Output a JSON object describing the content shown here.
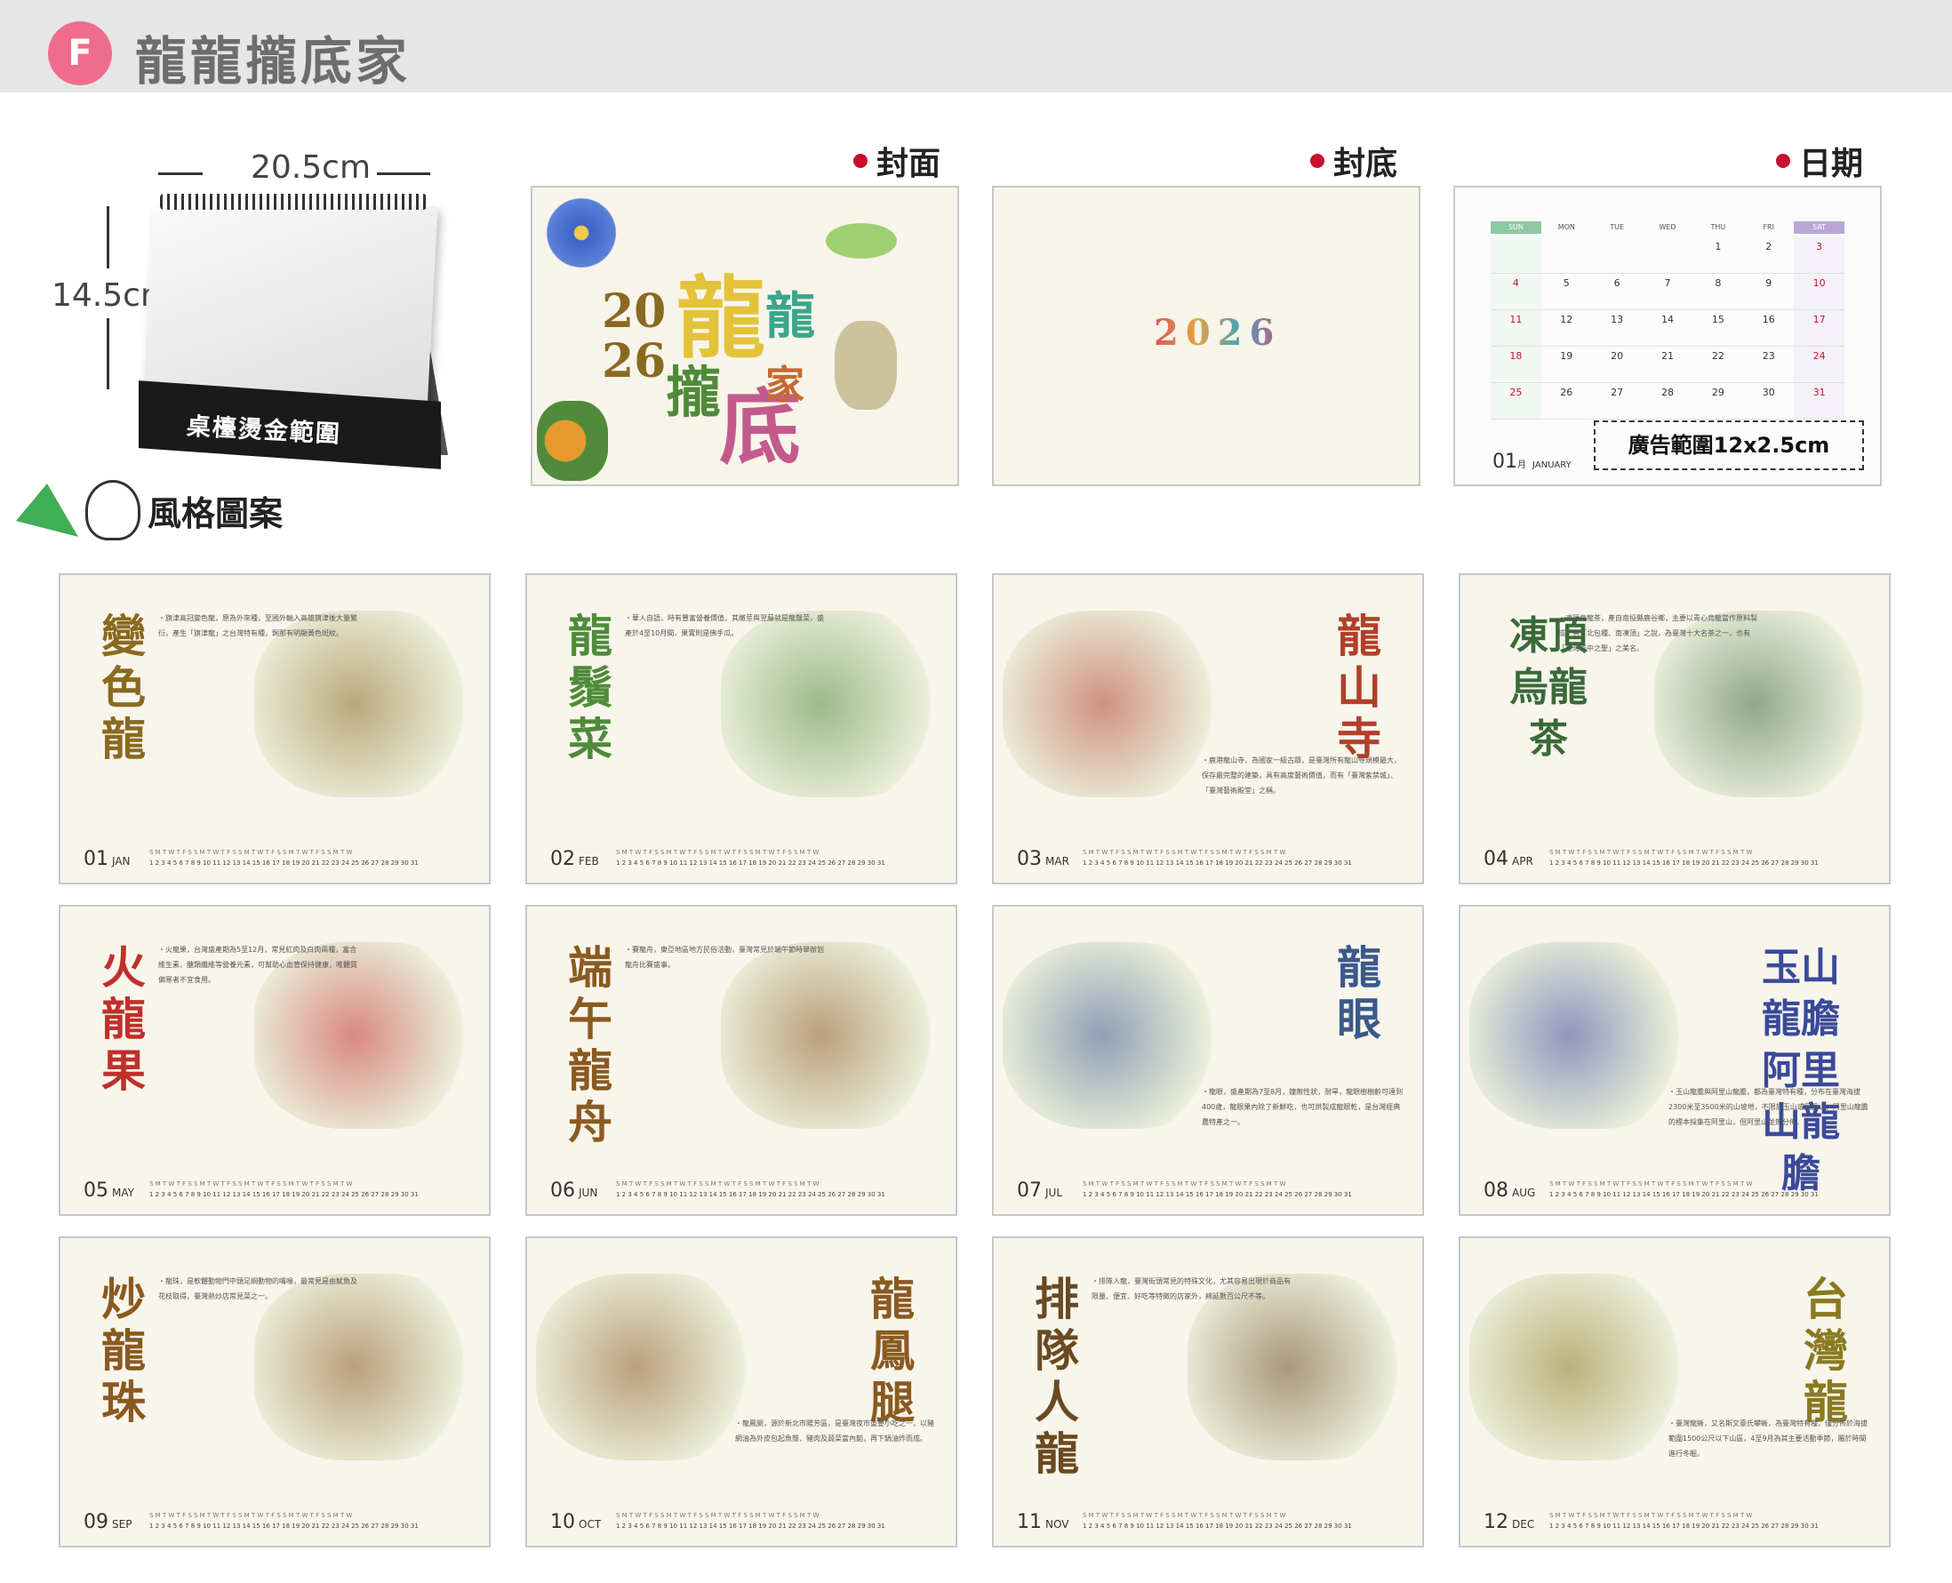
{
  "header": {
    "badge": "F",
    "title": "龍龍攏底家"
  },
  "product": {
    "width_label": "20.5cm",
    "height_label": "14.5cm",
    "base_label": "桌檯燙金範圍"
  },
  "previews": {
    "cover": {
      "label": "封面",
      "year_top": "20",
      "year_bottom": "26",
      "big1": "龍",
      "big2": "龍",
      "big3": "攏",
      "big4": "底",
      "big5": "家"
    },
    "back": {
      "label": "封底",
      "year": "2026"
    },
    "date": {
      "label": "日期",
      "weekdays": [
        "SUN",
        "MON",
        "TUE",
        "WED",
        "THU",
        "FRI",
        "SAT"
      ],
      "weeks": [
        [
          "",
          "",
          "",
          "",
          "1",
          "2",
          "3"
        ],
        [
          "4",
          "5",
          "6",
          "7",
          "8",
          "9",
          "10"
        ],
        [
          "11",
          "12",
          "13",
          "14",
          "15",
          "16",
          "17"
        ],
        [
          "18",
          "19",
          "20",
          "21",
          "22",
          "23",
          "24"
        ],
        [
          "25",
          "26",
          "27",
          "28",
          "29",
          "30",
          "31"
        ]
      ],
      "ad_label": "廣告範圍12x2.5cm",
      "month_num": "01",
      "month_cn": "月",
      "month_en": "JANUARY"
    }
  },
  "style_label": "風格圖案",
  "months": [
    {
      "num": "01",
      "en": "JAN",
      "title": "變色龍",
      "text": "・旗津高冠變色龍，原為外來種，至國外輸入高雄旗津後大量繁衍，產生「旗津龍」之台灣特有種，飼那有明顯黃色斑紋。"
    },
    {
      "num": "02",
      "en": "FEB",
      "title": "龍鬚菜",
      "text": "・華人自語，時有豐富營養價值，其嫩莖與翌藤就是龍鬚菜，盛產於4至10月間，果實則是佛手瓜。"
    },
    {
      "num": "03",
      "en": "MAR",
      "title": "龍山寺",
      "text": "・鹿港龍山寺，為國家一級古蹟，是臺灣所有龍山寺規模最大，保存最完整的建築，具有高度藝術價值，而有「臺灣紫禁城」、「臺灣藝術殿堂」之稱。"
    },
    {
      "num": "04",
      "en": "APR",
      "title": "凍頂烏龍茶",
      "text": "・凍頂烏龍茶，產自南投縣鹿谷鄉，主要以青心烏龍當作原料製成，有「北包種、南凍頂」之說，為臺灣十大名茶之一，也有「臺灣茶中之聖」之美名。"
    },
    {
      "num": "05",
      "en": "MAY",
      "title": "火龍果",
      "text": "・火龍果，台灣盛產期為5至12月，常見紅肉及白肉兩種，富含維生素、醣類纖維等營養元素，可幫助心血管保持健康，唯體質偏寒者不宜食用。"
    },
    {
      "num": "06",
      "en": "JUN",
      "title": "端午龍舟",
      "text": "・賽龍舟，東亞地區地方民俗活動，臺灣常見於端午節時舉辦划龍舟比賽盛事。"
    },
    {
      "num": "07",
      "en": "JUL",
      "title": "龍眼",
      "text": "・龍眼，盛產期為7至8月，鐘無性狀，耐旱，龍眼樹樹齡可達到400歲，龍眼果內除了新鮮吃，也可烘製成龍眼乾，是台灣經典農特產之一。"
    },
    {
      "num": "08",
      "en": "AUG",
      "title": "玉山龍膽 阿里山龍膽",
      "text": "・玉山龍膽與阿里山龍膽，都為臺灣特有種，分布在臺灣海拔2300米至3500米的山坡地，不限於玉山或阿里山，同里山龍膽的標本採集在阿里山，但阿里山並無分佈。"
    },
    {
      "num": "09",
      "en": "SEP",
      "title": "炒龍珠",
      "text": "・龍珠，是軟體動物門中頭足綱動物的嘴喙，最常見是由魷魚及花枝取得，臺灣熱炒店常見菜之一。"
    },
    {
      "num": "10",
      "en": "OCT",
      "title": "龍鳳腿",
      "text": "・龍鳳腿，源於新北市陽芳區，是臺灣夜市重要小吃之一，以豬網油為外皮包起魚漿、豬肉及蔬菜當內餡，再下鍋油炸而成。"
    },
    {
      "num": "11",
      "en": "NOV",
      "title": "排隊人龍",
      "text": "・排隊人龍，臺灣街頭常見的特殊文化，尤其容易出現於商品有限量、便宜、好吃等特徵的店家外，綿延數百公尺不等。"
    },
    {
      "num": "12",
      "en": "DEC",
      "title": "台灣龍",
      "text": "・臺灣龍蜥，又名斯文豪氏攀蜥，為臺灣特有種，僅分佈於海拔範圍1500公尺以下山區，4至9月為其主要活動季節，屬於時間進行冬眠。"
    }
  ],
  "colors": {
    "accent_red": "#c8102e",
    "badge_pink": "#ef6d8c",
    "gold": "#b89a3a",
    "green": "#6a9a3a",
    "red_title": "#c0302a"
  }
}
